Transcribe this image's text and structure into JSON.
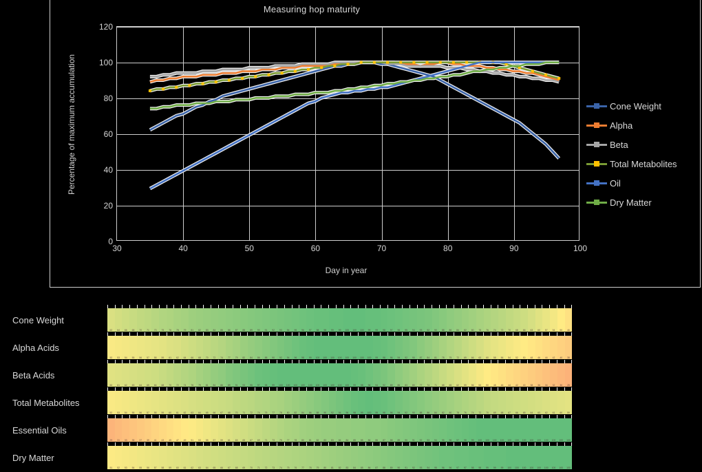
{
  "chart_panel": {
    "title": "Measuring hop maturity",
    "ylabel": "Percentage of maximum accumulation",
    "xlabel": "Day in year"
  },
  "legend": {
    "items": [
      {
        "label": "Cone Weight",
        "color": "#3a63a8"
      },
      {
        "label": "Alpha",
        "color": "#ed7d31"
      },
      {
        "label": "Beta",
        "color": "#a5a5a5"
      },
      {
        "label": "Total Metabolites",
        "color": "#7a9c34"
      },
      {
        "label": "Oil",
        "color": "#4472c4"
      },
      {
        "label": "Dry Matter",
        "color": "#70ad47"
      }
    ]
  },
  "heatmap": {
    "rows": [
      {
        "label": "Cone Weight"
      },
      {
        "label": "Alpha Acids"
      },
      {
        "label": "Beta Acids"
      },
      {
        "label": "Total Metabolites"
      },
      {
        "label": "Essential Oils"
      },
      {
        "label": "Dry Matter"
      }
    ]
  },
  "chart_data": {
    "type": "line",
    "title": "Measuring hop maturity",
    "xlabel": "Day in year",
    "ylabel": "Percentage of maximum accumulation",
    "xlim": [
      30,
      100
    ],
    "ylim": [
      0,
      120
    ],
    "xticks": [
      30,
      40,
      50,
      60,
      70,
      80,
      90,
      100
    ],
    "yticks": [
      0,
      20,
      40,
      60,
      80,
      100,
      120
    ],
    "grid": true,
    "legend_position": "right",
    "x": [
      35,
      36,
      37,
      38,
      39,
      40,
      41,
      42,
      43,
      44,
      45,
      46,
      47,
      48,
      49,
      50,
      51,
      52,
      53,
      54,
      55,
      56,
      57,
      58,
      59,
      60,
      61,
      62,
      63,
      64,
      65,
      66,
      67,
      68,
      69,
      70,
      71,
      72,
      73,
      74,
      75,
      76,
      77,
      78,
      79,
      80,
      81,
      82,
      83,
      84,
      85,
      86,
      87,
      88,
      89,
      90,
      91,
      92,
      93,
      94,
      95,
      96,
      97
    ],
    "series": [
      {
        "name": "Cone Weight",
        "color": "#3a63a8",
        "marker": "none",
        "values": [
          62,
          64,
          66,
          68,
          70,
          71,
          73,
          75,
          76,
          78,
          79,
          81,
          82,
          83,
          84,
          85,
          86,
          87,
          88,
          89,
          90,
          91,
          92,
          93,
          94,
          95,
          96,
          97,
          98,
          98,
          99,
          99,
          100,
          100,
          100,
          99,
          99,
          98,
          97,
          96,
          95,
          94,
          93,
          92,
          90,
          88,
          86,
          84,
          82,
          80,
          78,
          76,
          74,
          72,
          70,
          68,
          66,
          63,
          60,
          57,
          54,
          50,
          46
        ]
      },
      {
        "name": "Alpha",
        "color": "#ed7d31",
        "marker": "none",
        "values": [
          89,
          90,
          90,
          91,
          91,
          92,
          92,
          92,
          93,
          93,
          93,
          94,
          94,
          94,
          95,
          95,
          95,
          96,
          96,
          96,
          97,
          97,
          97,
          98,
          98,
          98,
          98,
          99,
          99,
          99,
          99,
          100,
          100,
          100,
          100,
          100,
          100,
          100,
          99,
          99,
          99,
          98,
          99,
          99,
          100,
          100,
          99,
          99,
          98,
          98,
          98,
          97,
          97,
          96,
          96,
          95,
          95,
          94,
          94,
          93,
          92,
          91,
          90
        ]
      },
      {
        "name": "Beta",
        "color": "#a5a5a5",
        "marker": "none",
        "values": [
          92,
          92,
          93,
          93,
          94,
          94,
          94,
          94,
          95,
          95,
          95,
          96,
          96,
          96,
          96,
          97,
          97,
          97,
          97,
          98,
          98,
          98,
          98,
          99,
          99,
          99,
          99,
          99,
          100,
          100,
          100,
          100,
          100,
          100,
          100,
          100,
          99,
          99,
          99,
          98,
          98,
          98,
          98,
          98,
          98,
          97,
          97,
          97,
          96,
          96,
          95,
          95,
          94,
          94,
          93,
          93,
          92,
          92,
          91,
          91,
          90,
          90,
          89
        ]
      },
      {
        "name": "Total Metabolites",
        "color": "#7a9c34",
        "marker": "circle",
        "values": [
          84,
          85,
          85,
          86,
          86,
          87,
          87,
          88,
          88,
          89,
          89,
          90,
          90,
          91,
          91,
          92,
          92,
          93,
          93,
          94,
          94,
          95,
          95,
          96,
          96,
          97,
          97,
          98,
          98,
          99,
          99,
          99,
          100,
          100,
          100,
          100,
          100,
          100,
          100,
          100,
          100,
          100,
          100,
          100,
          100,
          100,
          100,
          100,
          100,
          100,
          100,
          100,
          100,
          100,
          99,
          98,
          97,
          96,
          95,
          94,
          93,
          92,
          91
        ]
      },
      {
        "name": "Oil",
        "color": "#4472c4",
        "marker": "none",
        "values": [
          29,
          31,
          33,
          35,
          37,
          39,
          41,
          43,
          45,
          47,
          49,
          51,
          53,
          55,
          57,
          59,
          61,
          63,
          65,
          67,
          69,
          71,
          73,
          75,
          77,
          78,
          80,
          81,
          82,
          83,
          83,
          84,
          84,
          85,
          85,
          86,
          86,
          87,
          88,
          89,
          90,
          91,
          92,
          93,
          94,
          95,
          96,
          97,
          98,
          99,
          100,
          100,
          100,
          100,
          100,
          100,
          100,
          100,
          100,
          100,
          100,
          100,
          100
        ]
      },
      {
        "name": "Dry Matter",
        "color": "#70ad47",
        "marker": "none",
        "values": [
          74,
          74,
          75,
          75,
          76,
          76,
          76,
          77,
          77,
          77,
          78,
          78,
          78,
          79,
          79,
          79,
          80,
          80,
          80,
          81,
          81,
          81,
          82,
          82,
          82,
          83,
          83,
          83,
          84,
          84,
          85,
          85,
          86,
          86,
          87,
          87,
          88,
          88,
          89,
          89,
          90,
          90,
          91,
          91,
          92,
          92,
          93,
          93,
          94,
          95,
          95,
          96,
          96,
          97,
          97,
          98,
          98,
          99,
          99,
          99,
          100,
          100,
          100
        ]
      }
    ]
  },
  "heatmap_data": {
    "type": "heatmap",
    "colormap": "red-yellow-green",
    "columns": 63,
    "rows": [
      {
        "label": "Cone Weight",
        "values": [
          62,
          64,
          66,
          68,
          70,
          71,
          73,
          75,
          76,
          78,
          79,
          81,
          82,
          83,
          84,
          85,
          86,
          87,
          88,
          89,
          90,
          91,
          92,
          93,
          94,
          95,
          96,
          97,
          98,
          98,
          99,
          99,
          100,
          100,
          100,
          99,
          99,
          98,
          97,
          96,
          95,
          94,
          93,
          92,
          90,
          88,
          86,
          84,
          82,
          80,
          78,
          76,
          74,
          72,
          70,
          68,
          66,
          63,
          60,
          57,
          54,
          50,
          46
        ]
      },
      {
        "label": "Alpha Acids",
        "values": [
          52,
          53,
          54,
          55,
          56,
          57,
          58,
          59,
          61,
          62,
          64,
          66,
          68,
          70,
          72,
          74,
          77,
          79,
          82,
          84,
          86,
          88,
          90,
          92,
          94,
          96,
          98,
          99,
          100,
          100,
          100,
          100,
          100,
          100,
          100,
          100,
          99,
          98,
          96,
          94,
          92,
          90,
          87,
          84,
          81,
          78,
          75,
          72,
          69,
          66,
          63,
          60,
          58,
          56,
          54,
          52,
          50,
          48,
          46,
          44,
          42,
          40,
          38
        ]
      },
      {
        "label": "Beta Acids",
        "values": [
          60,
          61,
          62,
          63,
          64,
          65,
          66,
          68,
          70,
          72,
          74,
          76,
          79,
          81,
          84,
          86,
          89,
          91,
          93,
          95,
          97,
          98,
          99,
          100,
          100,
          100,
          100,
          100,
          100,
          100,
          100,
          100,
          100,
          99,
          98,
          96,
          94,
          92,
          89,
          86,
          83,
          80,
          77,
          74,
          71,
          68,
          65,
          62,
          59,
          56,
          53,
          50,
          48,
          46,
          44,
          42,
          40,
          38,
          36,
          34,
          32,
          30,
          28
        ]
      },
      {
        "label": "Total Metabolites",
        "values": [
          52,
          53,
          54,
          55,
          56,
          57,
          58,
          59,
          60,
          61,
          62,
          63,
          64,
          65,
          66,
          67,
          68,
          70,
          71,
          72,
          74,
          75,
          77,
          78,
          80,
          82,
          84,
          86,
          88,
          90,
          92,
          94,
          96,
          98,
          99,
          100,
          99,
          98,
          96,
          94,
          92,
          90,
          88,
          86,
          84,
          82,
          80,
          78,
          76,
          74,
          72,
          70,
          69,
          68,
          67,
          66,
          65,
          64,
          63,
          62,
          61,
          60,
          59
        ]
      },
      {
        "label": "Essential Oils",
        "values": [
          29,
          31,
          33,
          35,
          37,
          39,
          41,
          43,
          45,
          47,
          49,
          51,
          53,
          55,
          57,
          59,
          61,
          63,
          65,
          67,
          69,
          71,
          73,
          75,
          77,
          78,
          80,
          81,
          82,
          83,
          83,
          84,
          84,
          85,
          85,
          86,
          86,
          87,
          88,
          89,
          90,
          91,
          92,
          93,
          94,
          95,
          96,
          97,
          98,
          99,
          100,
          100,
          100,
          100,
          100,
          100,
          100,
          100,
          100,
          100,
          100,
          100,
          100
        ]
      },
      {
        "label": "Dry Matter",
        "values": [
          51,
          52,
          53,
          54,
          55,
          56,
          57,
          58,
          59,
          60,
          61,
          62,
          63,
          64,
          65,
          66,
          67,
          68,
          69,
          70,
          71,
          72,
          73,
          74,
          75,
          76,
          77,
          78,
          79,
          80,
          81,
          82,
          83,
          84,
          85,
          86,
          87,
          88,
          89,
          90,
          91,
          92,
          93,
          94,
          95,
          96,
          96,
          97,
          97,
          98,
          98,
          99,
          99,
          99,
          100,
          100,
          100,
          100,
          100,
          100,
          100,
          100,
          100
        ]
      }
    ]
  }
}
